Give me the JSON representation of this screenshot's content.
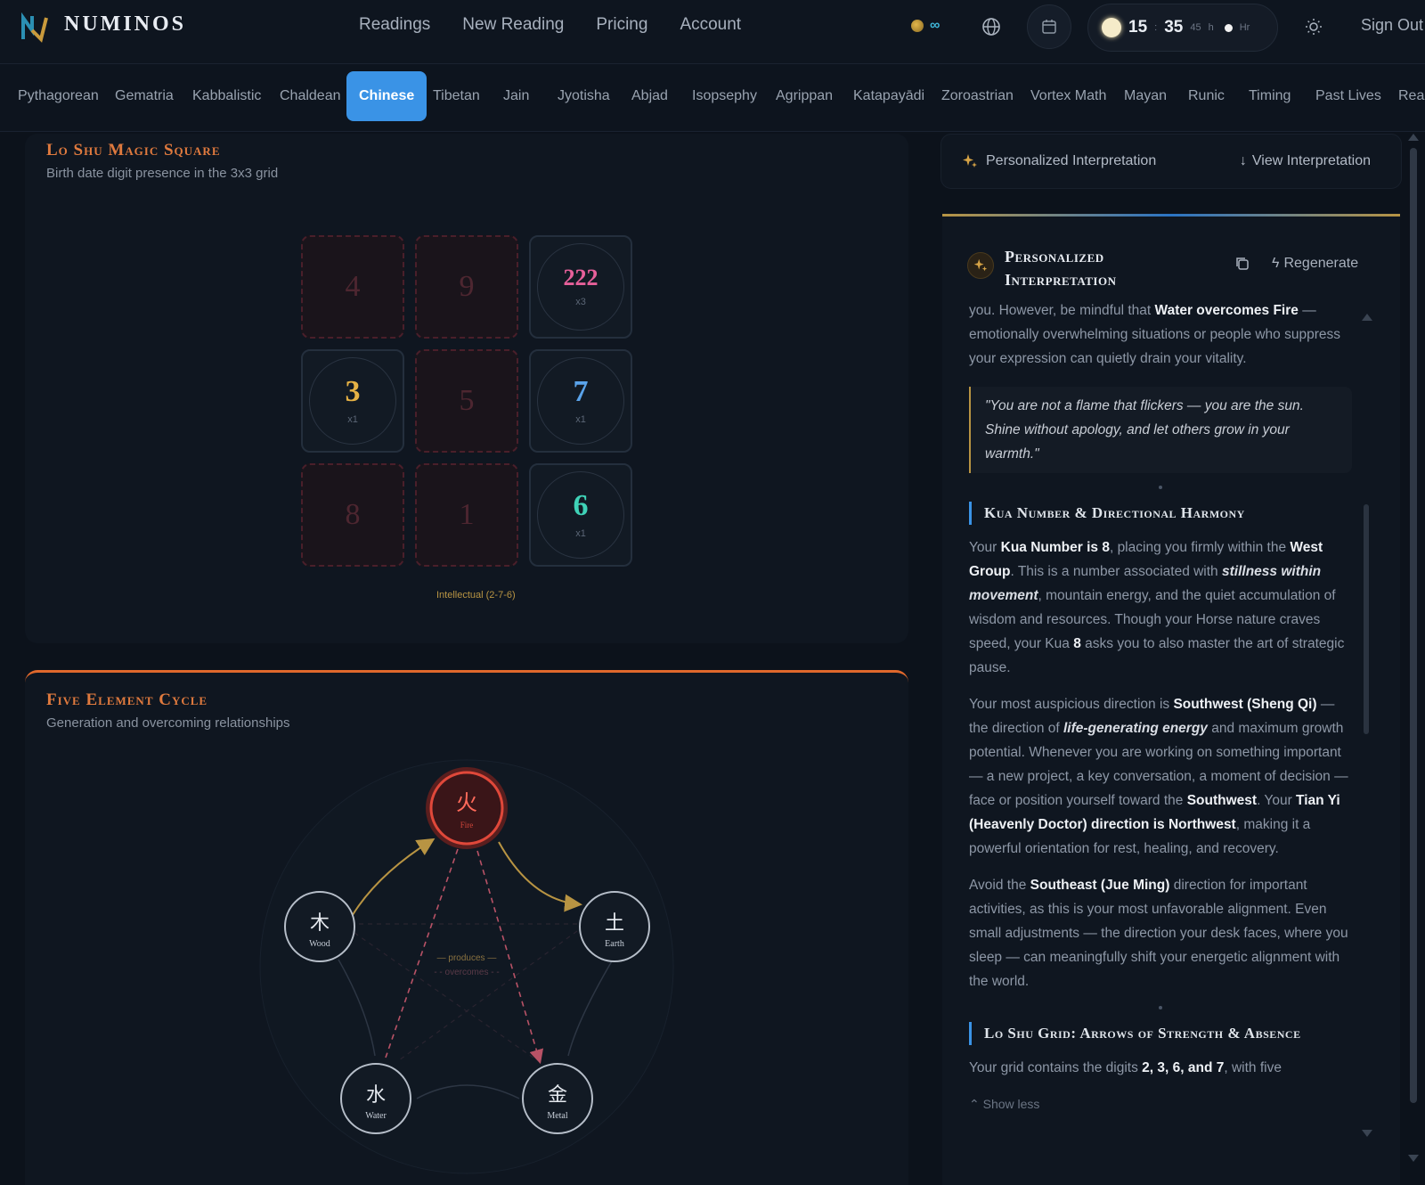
{
  "brand": {
    "name": "NUMINOS"
  },
  "nav": {
    "links": [
      "Readings",
      "New Reading",
      "Pricing",
      "Account"
    ],
    "credits_symbol": "∞",
    "time": {
      "hour": "15",
      "minute": "35",
      "second": "45",
      "h_label": "h",
      "hr_label": "Hr"
    },
    "sign_out": "Sign Out"
  },
  "tabs": [
    "Pythagorean",
    "Gematria",
    "Kabbalistic",
    "Chaldean",
    "Chinese",
    "Tibetan",
    "Jain",
    "Jyotisha",
    "Abjad",
    "Isopsephy",
    "Agrippan",
    "Katapayādi",
    "Zoroastrian",
    "Vortex Math",
    "Mayan",
    "Runic",
    "Timing",
    "Past Lives",
    "Real"
  ],
  "active_tab": "Chinese",
  "lo_shu": {
    "title": "Lo Shu Magic Square",
    "subtitle": "Birth date digit presence in the 3x3 grid",
    "cells": [
      {
        "digit": "4",
        "value": "4",
        "count": "",
        "filled": false,
        "color": ""
      },
      {
        "digit": "9",
        "value": "9",
        "count": "",
        "filled": false,
        "color": ""
      },
      {
        "digit": "2",
        "value": "222",
        "count": "x3",
        "filled": true,
        "color": "#e6609a"
      },
      {
        "digit": "3",
        "value": "3",
        "count": "x1",
        "filled": true,
        "color": "#e6b245"
      },
      {
        "digit": "5",
        "value": "5",
        "count": "",
        "filled": false,
        "color": ""
      },
      {
        "digit": "7",
        "value": "7",
        "count": "x1",
        "filled": true,
        "color": "#5aa3ea"
      },
      {
        "digit": "8",
        "value": "8",
        "count": "",
        "filled": false,
        "color": ""
      },
      {
        "digit": "1",
        "value": "1",
        "count": "",
        "filled": false,
        "color": ""
      },
      {
        "digit": "6",
        "value": "6",
        "count": "x1",
        "filled": true,
        "color": "#3fd2b7"
      }
    ],
    "arrow_label": "Intellectual (2-7-6)"
  },
  "five_elements": {
    "title": "Five Element Cycle",
    "subtitle": "Generation and overcoming relationships",
    "legend_produces": "— produces —",
    "legend_overcomes": "- - overcomes - -",
    "nodes": [
      {
        "key": "fire",
        "glyph": "火",
        "label": "Fire",
        "active": true
      },
      {
        "key": "earth",
        "glyph": "土",
        "label": "Earth",
        "active": false
      },
      {
        "key": "metal",
        "glyph": "金",
        "label": "Metal",
        "active": false
      },
      {
        "key": "water",
        "glyph": "水",
        "label": "Water",
        "active": false
      },
      {
        "key": "wood",
        "glyph": "木",
        "label": "Wood",
        "active": false
      }
    ]
  },
  "right": {
    "personalized_label": "Personalized Interpretation",
    "view_label": "View Interpretation",
    "interp_title": "Personalized Interpretation",
    "regenerate": "Regenerate",
    "intro_cut": "you. However, be mindful that",
    "intro_cut_bold": "Water overcomes Fire",
    "intro_rest": "— emotionally overwhelming situations or people who suppress your expression can quietly drain your vitality.",
    "quote": "\"You are not a flame that flickers — you are the sun. Shine without apology, and let others grow in your warmth.\"",
    "section1_title": "Kua Number & Directional Harmony",
    "p1": {
      "a": "Your",
      "b": "Kua Number is 8",
      "c": ", placing you firmly within the",
      "d": "West Group",
      "e": ". This is a number associated with",
      "f": "stillness within movement",
      "g": ", mountain energy, and the quiet accumulation of wisdom and resources. Though your Horse nature craves speed, your Kua",
      "h": "8",
      "i": "asks you to also master the art of strategic pause."
    },
    "p2": {
      "a": "Your most auspicious direction is",
      "b": "Southwest (Sheng Qi)",
      "c": "— the direction of",
      "d": "life-generating energy",
      "e": "and maximum growth potential. Whenever you are working on something important — a new project, a key conversation, a moment of decision — face or position yourself toward the",
      "f": "Southwest",
      "g": ". Your",
      "h": "Tian Yi (Heavenly Doctor) direction is Northwest",
      "i": ", making it a powerful orientation for rest, healing, and recovery."
    },
    "p3": {
      "a": "Avoid the",
      "b": "Southeast (Jue Ming)",
      "c": "direction for important activities, as this is your most unfavorable alignment. Even small adjustments — the direction your desk faces, where you sleep — can meaningfully shift your energetic alignment with the world."
    },
    "section2_title": "Lo Shu Grid: Arrows of Strength & Absence",
    "p4": {
      "a": "Your grid contains the digits",
      "b": "2, 3, 6, and 7",
      "c": ", with five"
    },
    "show_less": "Show less"
  },
  "colors": {
    "accent": "#3a93e6",
    "orange": "#e0682c",
    "gold": "#b89443",
    "fire": "#e0483a"
  }
}
